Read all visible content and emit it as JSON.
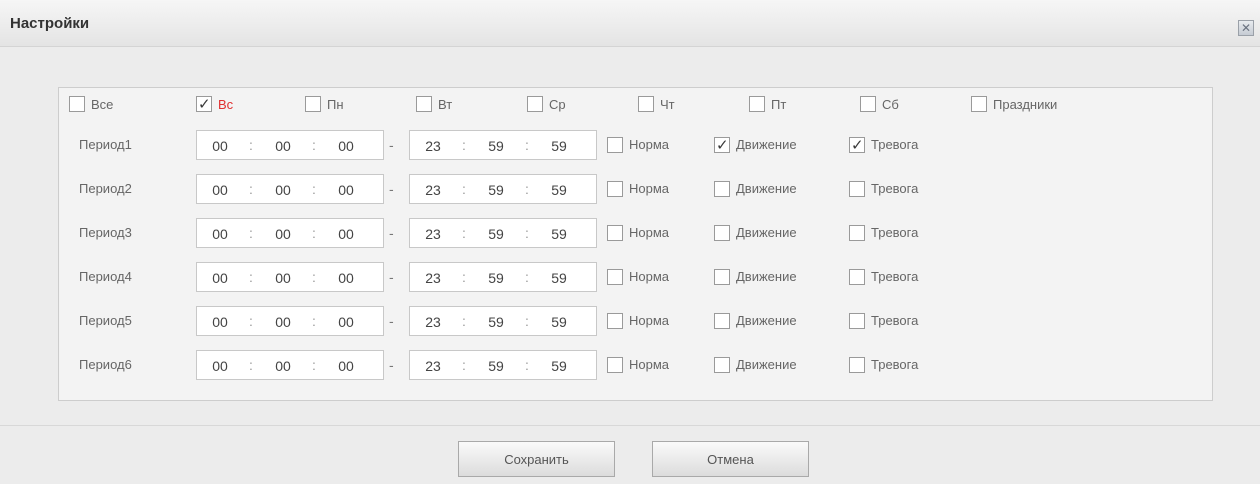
{
  "dialog": {
    "title": "Настройки",
    "close_icon": "close-icon"
  },
  "days": [
    {
      "label": "Все",
      "checked": false,
      "red": false
    },
    {
      "label": "Вс",
      "checked": true,
      "red": true
    },
    {
      "label": "Пн",
      "checked": false,
      "red": false
    },
    {
      "label": "Вт",
      "checked": false,
      "red": false
    },
    {
      "label": "Ср",
      "checked": false,
      "red": false
    },
    {
      "label": "Чт",
      "checked": false,
      "red": false
    },
    {
      "label": "Пт",
      "checked": false,
      "red": false
    },
    {
      "label": "Сб",
      "checked": false,
      "red": false
    },
    {
      "label": "Праздники",
      "checked": false,
      "red": false
    }
  ],
  "periods": [
    {
      "label": "Период1",
      "start": [
        "00",
        "00",
        "00"
      ],
      "end": [
        "23",
        "59",
        "59"
      ],
      "norma": false,
      "motion": true,
      "alarm": true
    },
    {
      "label": "Период2",
      "start": [
        "00",
        "00",
        "00"
      ],
      "end": [
        "23",
        "59",
        "59"
      ],
      "norma": false,
      "motion": false,
      "alarm": false
    },
    {
      "label": "Период3",
      "start": [
        "00",
        "00",
        "00"
      ],
      "end": [
        "23",
        "59",
        "59"
      ],
      "norma": false,
      "motion": false,
      "alarm": false
    },
    {
      "label": "Период4",
      "start": [
        "00",
        "00",
        "00"
      ],
      "end": [
        "23",
        "59",
        "59"
      ],
      "norma": false,
      "motion": false,
      "alarm": false
    },
    {
      "label": "Период5",
      "start": [
        "00",
        "00",
        "00"
      ],
      "end": [
        "23",
        "59",
        "59"
      ],
      "norma": false,
      "motion": false,
      "alarm": false
    },
    {
      "label": "Период6",
      "start": [
        "00",
        "00",
        "00"
      ],
      "end": [
        "23",
        "59",
        "59"
      ],
      "norma": false,
      "motion": false,
      "alarm": false
    }
  ],
  "labels": {
    "norma": "Норма",
    "motion": "Движение",
    "alarm": "Тревога",
    "time_sep": ":",
    "range_sep": "-"
  },
  "buttons": {
    "save": "Сохранить",
    "cancel": "Отмена"
  }
}
